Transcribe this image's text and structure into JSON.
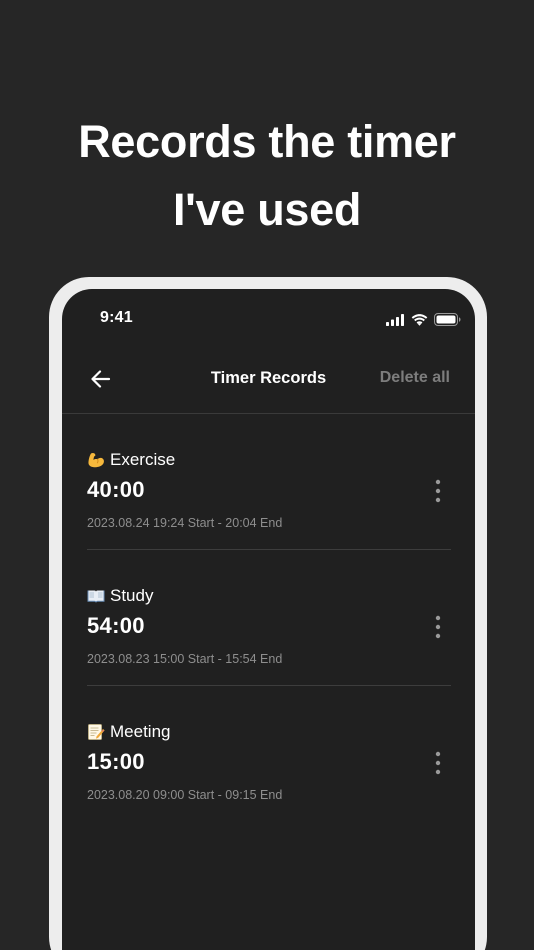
{
  "headline": {
    "line1": "Records the timer",
    "line2": "I've used"
  },
  "status_bar": {
    "time": "9:41",
    "icons": [
      "signal-icon",
      "wifi-icon",
      "battery-icon"
    ]
  },
  "header": {
    "back_icon": "arrow-left-icon",
    "title": "Timer Records",
    "delete_all_label": "Delete all"
  },
  "records": [
    {
      "icon": "flexed-biceps-emoji",
      "name": "Exercise",
      "duration": "40:00",
      "range": "2023.08.24 19:24 Start - 20:04 End"
    },
    {
      "icon": "open-book-emoji",
      "name": "Study",
      "duration": "54:00",
      "range": "2023.08.23 15:00 Start - 15:54 End"
    },
    {
      "icon": "memo-emoji",
      "name": "Meeting",
      "duration": "15:00",
      "range": "2023.08.20 09:00 Start - 09:15 End"
    }
  ],
  "colors": {
    "background": "#262626",
    "screen": "#202020",
    "frame": "#ededed",
    "muted_text": "#8e8e8e",
    "delete_text": "#7d7d7d"
  }
}
